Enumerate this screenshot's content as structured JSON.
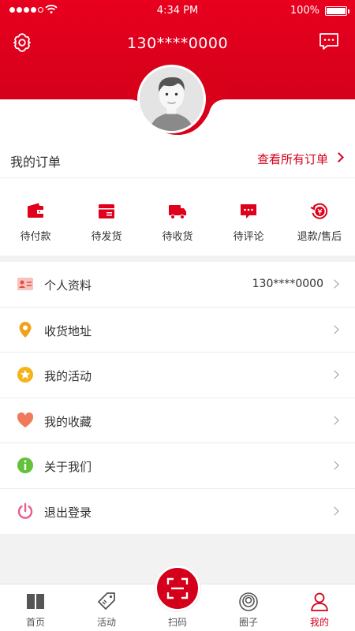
{
  "status_bar": {
    "time": "4:34 PM",
    "battery": "100%"
  },
  "header": {
    "phone": "130****0000"
  },
  "orders": {
    "title": "我的订单",
    "view_all": "查看所有订单",
    "items": [
      {
        "label": "待付款",
        "icon": "wallet-icon"
      },
      {
        "label": "待发货",
        "icon": "box-icon"
      },
      {
        "label": "待收货",
        "icon": "truck-icon"
      },
      {
        "label": "待评论",
        "icon": "comment-icon"
      },
      {
        "label": "退款/售后",
        "icon": "refund-icon"
      }
    ]
  },
  "menu": [
    {
      "label": "个人资料",
      "value": "130****0000",
      "icon": "id-card-icon",
      "color": "#e8483e"
    },
    {
      "label": "收货地址",
      "value": "",
      "icon": "location-pin-icon",
      "color": "#f0a21e"
    },
    {
      "label": "我的活动",
      "value": "",
      "icon": "star-icon",
      "color": "#f5b31c"
    },
    {
      "label": "我的收藏",
      "value": "",
      "icon": "heart-icon",
      "color": "#f07a5c"
    },
    {
      "label": "关于我们",
      "value": "",
      "icon": "info-icon",
      "color": "#63c23a"
    },
    {
      "label": "退出登录",
      "value": "",
      "icon": "power-icon",
      "color": "#ea5c8a"
    }
  ],
  "tabbar": [
    {
      "label": "首页",
      "icon": "book-icon"
    },
    {
      "label": "活动",
      "icon": "tag-icon"
    },
    {
      "label": "扫码",
      "icon": "scan-icon"
    },
    {
      "label": "圈子",
      "icon": "circles-icon"
    },
    {
      "label": "我的",
      "icon": "person-icon",
      "active": true
    }
  ],
  "colors": {
    "brand": "#d4001b",
    "accent_text": "#d4001b"
  }
}
